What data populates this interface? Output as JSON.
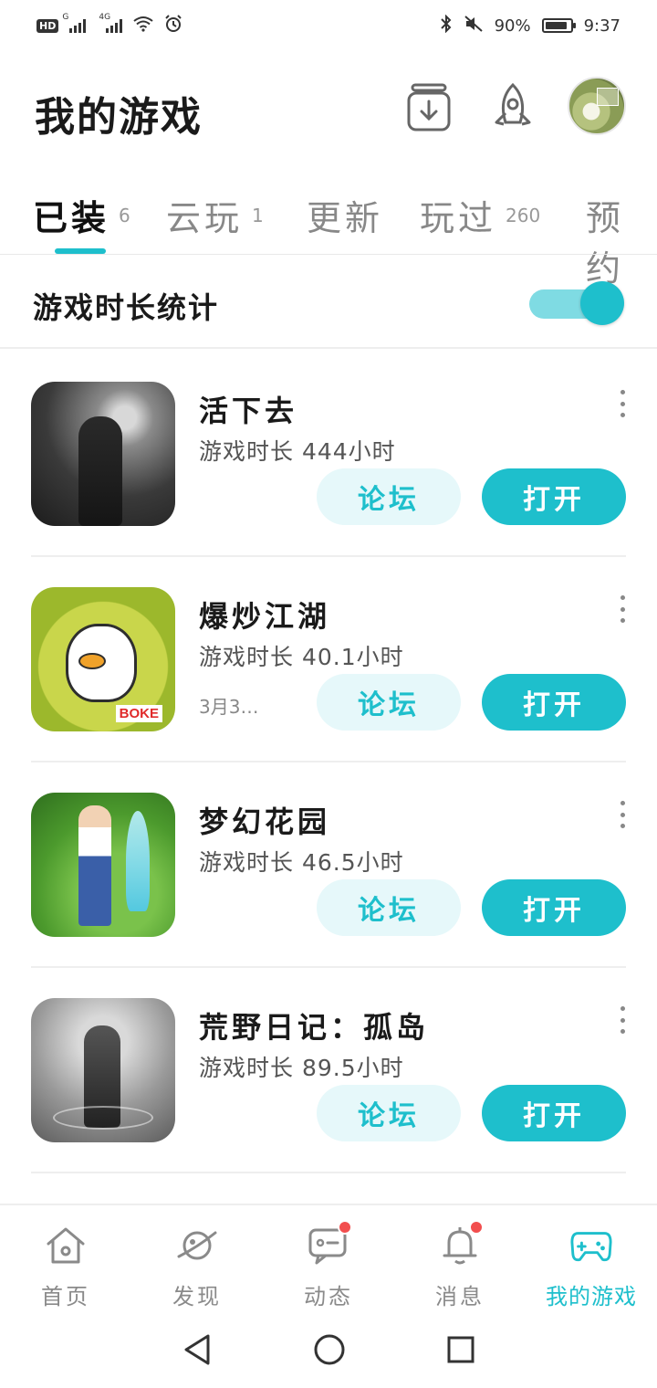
{
  "status_bar": {
    "hd": "HD",
    "sim1": "G",
    "sim2": "4G",
    "battery_text": "90%",
    "battery_level": 0.9,
    "time": "9:37"
  },
  "header": {
    "title": "我的游戏",
    "icons": [
      "download-box-icon",
      "rocket-icon"
    ],
    "avatar": "profile-avatar"
  },
  "tabs": [
    {
      "label": "已装",
      "count": "6",
      "active": true
    },
    {
      "label": "云玩",
      "count": "1",
      "active": false
    },
    {
      "label": "更新",
      "count": "",
      "active": false
    },
    {
      "label": "玩过",
      "count": "260",
      "active": false
    },
    {
      "label": "预约",
      "count": "",
      "active": false
    }
  ],
  "stats": {
    "label": "游戏时长统计",
    "toggle_on": true
  },
  "accent_color": "#1ebfcc",
  "games": [
    {
      "name": "活下去",
      "playtime": "游戏时长 444小时",
      "extra": "",
      "forum": "论坛",
      "open": "打开"
    },
    {
      "name": "爆炒江湖",
      "playtime": "游戏时长 40.1小时",
      "extra": "3月3…",
      "forum": "论坛",
      "open": "打开"
    },
    {
      "name": "梦幻花园",
      "playtime": "游戏时长 46.5小时",
      "extra": "",
      "forum": "论坛",
      "open": "打开"
    },
    {
      "name": "荒野日记：孤岛",
      "playtime": "游戏时长 89.5小时",
      "extra": "",
      "forum": "论坛",
      "open": "打开"
    }
  ],
  "bottom_nav": [
    {
      "label": "首页",
      "icon": "home-icon",
      "active": false,
      "dot": false
    },
    {
      "label": "发现",
      "icon": "planet-icon",
      "active": false,
      "dot": false
    },
    {
      "label": "动态",
      "icon": "feed-icon",
      "active": false,
      "dot": true
    },
    {
      "label": "消息",
      "icon": "bell-icon",
      "active": false,
      "dot": true
    },
    {
      "label": "我的游戏",
      "icon": "gamepad-icon",
      "active": true,
      "dot": false
    }
  ],
  "icon_badge_text": "BOKE"
}
